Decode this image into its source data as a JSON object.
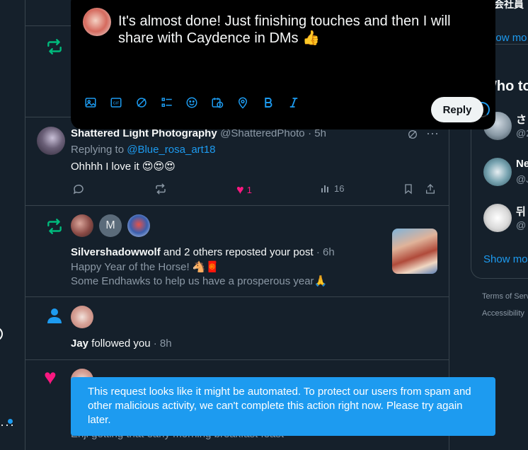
{
  "composer": {
    "text": "It's almost done! Just finishing touches and then I will share with Caydence in DMs",
    "text_emoji": "👍",
    "reply_label": "Reply"
  },
  "notif_repost_top": {
    "partial_text": ""
  },
  "reply_item": {
    "name": "Shattered Light Photography",
    "handle": "@ShatteredPhoto",
    "time": "· 5h",
    "replying_prefix": "Replying to",
    "replying_to": "@Blue_rosa_art18",
    "text": "Ohhhh I love it 😍😍😍",
    "likes": "1",
    "views": "16"
  },
  "repost_item": {
    "avatar_m_letter": "M",
    "actor": "Silvershadowwolf",
    "rest": "and 2 others reposted your post",
    "time": "· 6h",
    "line1": "Happy Year of the Horse! 🐴🧧",
    "line2": "Some Endhawks to help us have a prosperous year🙏"
  },
  "follow_item": {
    "actor": "Jay",
    "rest": "followed you",
    "time": "· 8h"
  },
  "like_item": {
    "partial_text": "Enji getting that early morning breakfast feast"
  },
  "right": {
    "top_partial": "会社員",
    "show_more_top": "Show mo",
    "who_to_follow": "Who to",
    "users": [
      {
        "name": "さ",
        "handle": "@2"
      },
      {
        "name": "Ne",
        "handle": "@J"
      },
      {
        "name": "뒤",
        "handle": "@"
      }
    ],
    "show_more_bottom": "Show mo",
    "footer1": "Terms of Serv",
    "footer2": "Accessibility"
  },
  "toast": {
    "message": "This request looks like it might be automated. To protect our users from spam and other malicious activity, we can't complete this action right now. Please try again later."
  },
  "colors": {
    "background": "#15202b",
    "accent": "#1d9bf0",
    "repost_green": "#00ba7c",
    "like_pink": "#f91880",
    "border": "#38444d"
  }
}
